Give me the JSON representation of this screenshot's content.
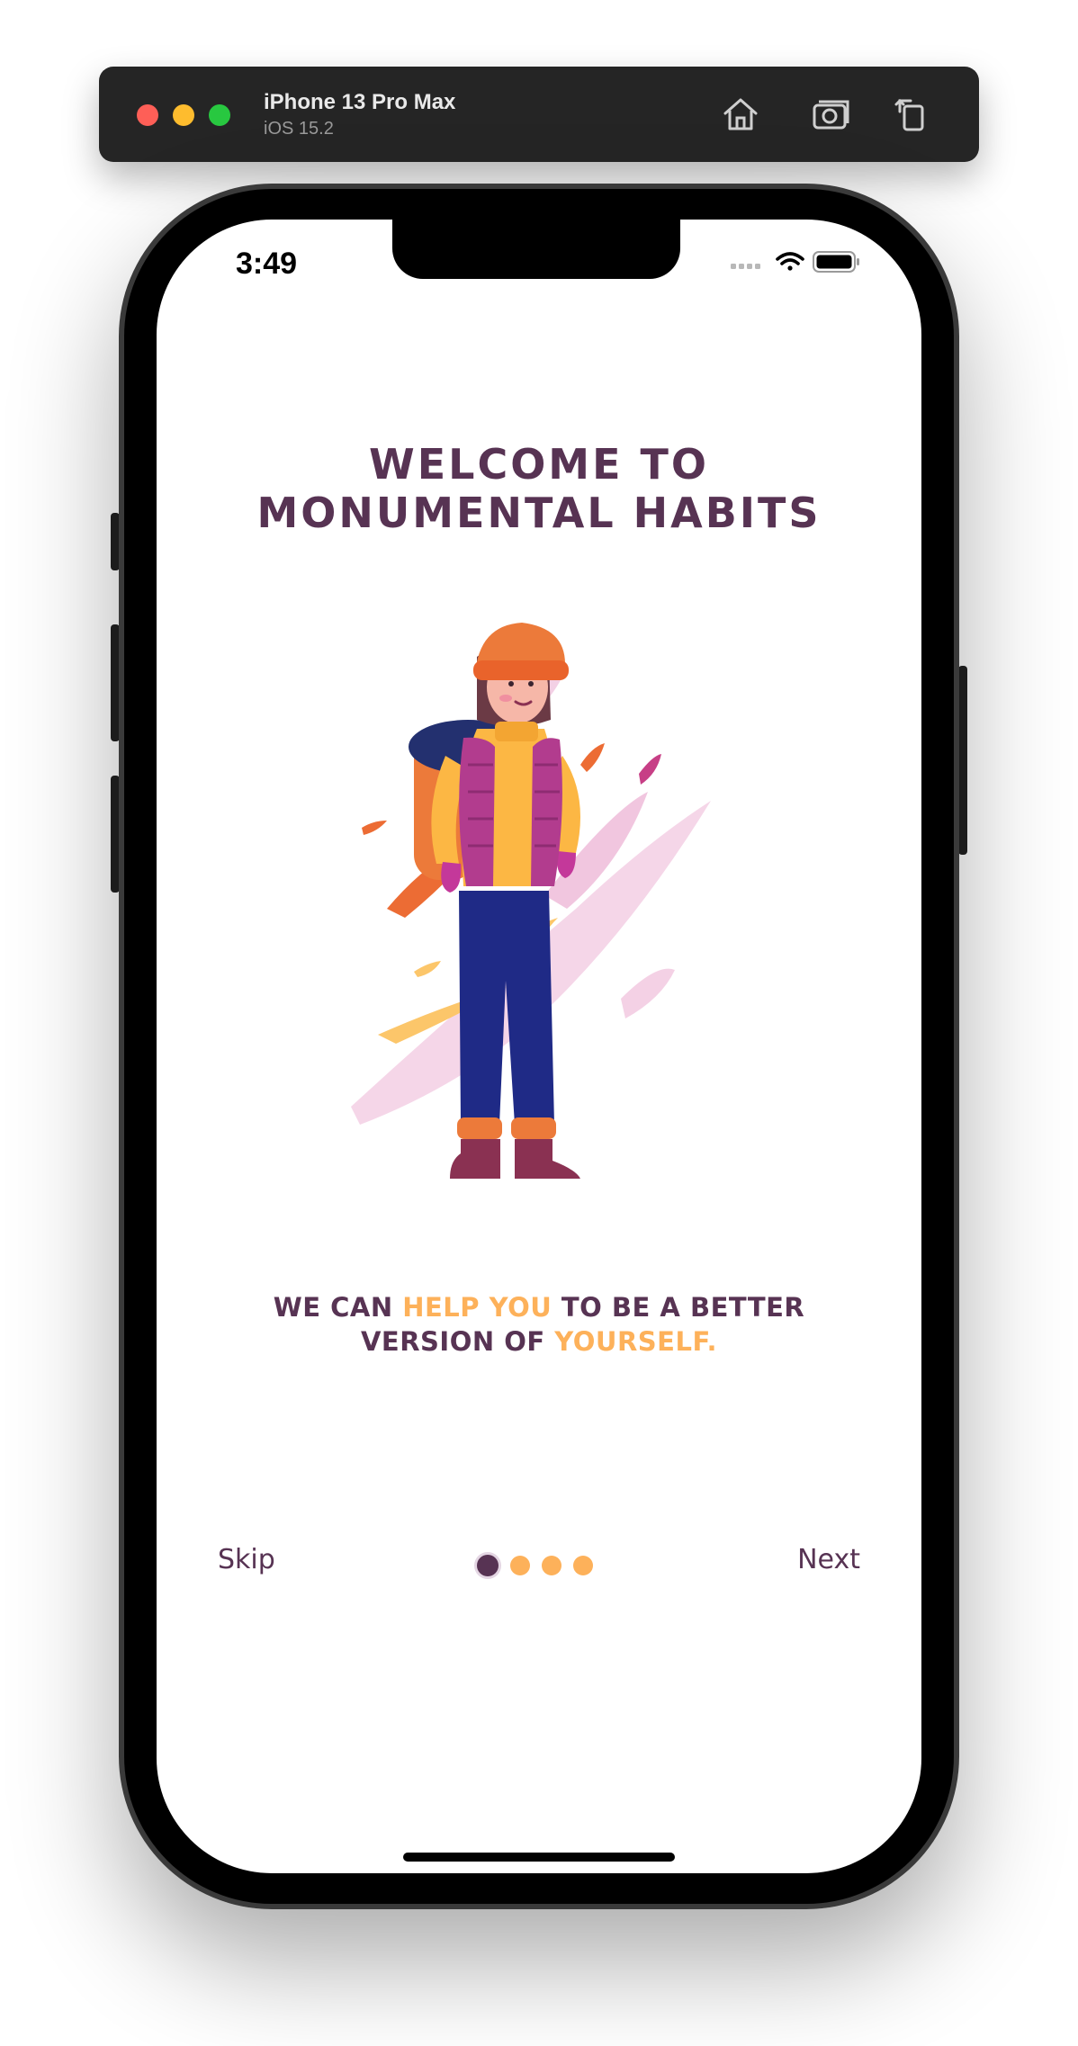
{
  "simulator": {
    "device_name": "iPhone 13 Pro Max",
    "os_version": "iOS 15.2",
    "icons": [
      "home-icon",
      "screenshot-icon",
      "rotate-icon"
    ]
  },
  "status_bar": {
    "time": "3:49",
    "icons": [
      "signal-icon",
      "wifi-icon",
      "battery-icon"
    ]
  },
  "onboarding": {
    "title_line1": "WELCOME TO",
    "title_line2": "MONUMENTAL HABITS",
    "tagline": {
      "part1": "WE CAN ",
      "highlight1": "HELP YOU",
      "part2": " TO BE A BETTER",
      "part3": "VERSION OF ",
      "highlight2": "YOURSELF."
    },
    "skip_label": "Skip",
    "next_label": "Next",
    "page_count": 4,
    "active_page": 1
  },
  "colors": {
    "primary": "#573353",
    "accent": "#fdb15a",
    "background": "#ffffff"
  }
}
